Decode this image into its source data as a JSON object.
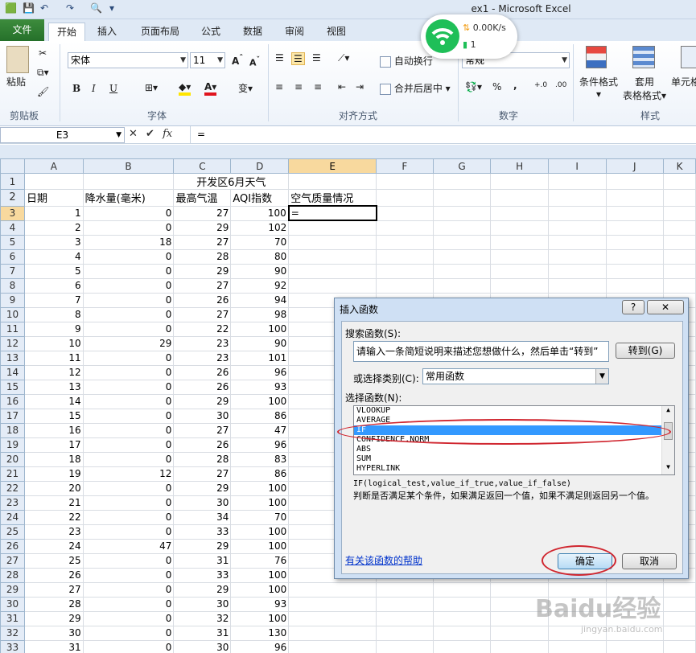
{
  "window": {
    "title": "ex1 - Microsoft Excel"
  },
  "tabs": [
    "开始",
    "插入",
    "页面布局",
    "公式",
    "数据",
    "审阅",
    "视图"
  ],
  "file_tab": "文件",
  "ribbon": {
    "paste": "粘贴",
    "font_name": "宋体",
    "font_size": "11",
    "bold": "B",
    "italic": "I",
    "underline": "U",
    "wrap_text": "自动换行",
    "merge_center": "合并后居中",
    "number_format": "常规",
    "percent": "%",
    "comma": ",",
    "cond_format": "条件格式",
    "table_format_1": "套用",
    "table_format_2": "表格格式",
    "cell_styles": "单元格",
    "groups": {
      "clipboard": "剪贴板",
      "font": "字体",
      "alignment": "对齐方式",
      "number": "数字",
      "styles": "样式"
    }
  },
  "wifi_badge": {
    "speed": "0.00K/s",
    "count": "1"
  },
  "formula_bar": {
    "name_box": "E3",
    "formula": "="
  },
  "columns": [
    "A",
    "B",
    "C",
    "D",
    "E",
    "F",
    "G",
    "H",
    "I",
    "J",
    "K"
  ],
  "sheet": {
    "title": "开发区6月天气",
    "headers": [
      "日期",
      "降水量(毫米)",
      "最高气温",
      "AQI指数",
      "空气质量情况"
    ],
    "rows": [
      {
        "r": "3",
        "a": "1",
        "b": "0",
        "c": "27",
        "d": "100",
        "e": "="
      },
      {
        "r": "4",
        "a": "2",
        "b": "0",
        "c": "29",
        "d": "102"
      },
      {
        "r": "5",
        "a": "3",
        "b": "18",
        "c": "27",
        "d": "70"
      },
      {
        "r": "6",
        "a": "4",
        "b": "0",
        "c": "28",
        "d": "80"
      },
      {
        "r": "7",
        "a": "5",
        "b": "0",
        "c": "29",
        "d": "90"
      },
      {
        "r": "8",
        "a": "6",
        "b": "0",
        "c": "27",
        "d": "92"
      },
      {
        "r": "9",
        "a": "7",
        "b": "0",
        "c": "26",
        "d": "94"
      },
      {
        "r": "10",
        "a": "8",
        "b": "0",
        "c": "27",
        "d": "98"
      },
      {
        "r": "11",
        "a": "9",
        "b": "0",
        "c": "22",
        "d": "100"
      },
      {
        "r": "12",
        "a": "10",
        "b": "29",
        "c": "23",
        "d": "90"
      },
      {
        "r": "13",
        "a": "11",
        "b": "0",
        "c": "23",
        "d": "101"
      },
      {
        "r": "14",
        "a": "12",
        "b": "0",
        "c": "26",
        "d": "96"
      },
      {
        "r": "15",
        "a": "13",
        "b": "0",
        "c": "26",
        "d": "93"
      },
      {
        "r": "16",
        "a": "14",
        "b": "0",
        "c": "29",
        "d": "100"
      },
      {
        "r": "17",
        "a": "15",
        "b": "0",
        "c": "30",
        "d": "86"
      },
      {
        "r": "18",
        "a": "16",
        "b": "0",
        "c": "27",
        "d": "47"
      },
      {
        "r": "19",
        "a": "17",
        "b": "0",
        "c": "26",
        "d": "96"
      },
      {
        "r": "20",
        "a": "18",
        "b": "0",
        "c": "28",
        "d": "83"
      },
      {
        "r": "21",
        "a": "19",
        "b": "12",
        "c": "27",
        "d": "86"
      },
      {
        "r": "22",
        "a": "20",
        "b": "0",
        "c": "29",
        "d": "100"
      },
      {
        "r": "23",
        "a": "21",
        "b": "0",
        "c": "30",
        "d": "100"
      },
      {
        "r": "24",
        "a": "22",
        "b": "0",
        "c": "34",
        "d": "70"
      },
      {
        "r": "25",
        "a": "23",
        "b": "0",
        "c": "33",
        "d": "100"
      },
      {
        "r": "26",
        "a": "24",
        "b": "47",
        "c": "29",
        "d": "100"
      },
      {
        "r": "27",
        "a": "25",
        "b": "0",
        "c": "31",
        "d": "76"
      },
      {
        "r": "28",
        "a": "26",
        "b": "0",
        "c": "33",
        "d": "100"
      },
      {
        "r": "29",
        "a": "27",
        "b": "0",
        "c": "29",
        "d": "100"
      },
      {
        "r": "30",
        "a": "28",
        "b": "0",
        "c": "30",
        "d": "93"
      },
      {
        "r": "31",
        "a": "29",
        "b": "0",
        "c": "32",
        "d": "100"
      },
      {
        "r": "32",
        "a": "30",
        "b": "0",
        "c": "31",
        "d": "130"
      },
      {
        "r": "33",
        "a": "31",
        "b": "0",
        "c": "30",
        "d": "96"
      }
    ]
  },
  "dialog": {
    "title": "插入函数",
    "help_btn": "?",
    "close_btn": "✕",
    "search_label": "搜索函数(S):",
    "search_value": "请输入一条简短说明来描述您想做什么，然后单击“转到”",
    "go_btn": "转到(G)",
    "category_label": "或选择类别(C):",
    "category_value": "常用函数",
    "select_label": "选择函数(N):",
    "functions": [
      "VLOOKUP",
      "AVERAGE",
      "IF",
      "CONFIDENCE.NORM",
      "ABS",
      "SUM",
      "HYPERLINK"
    ],
    "selected_function": "IF",
    "signature": "IF(logical_test,value_if_true,value_if_false)",
    "description": "判断是否满足某个条件，如果满足返回一个值，如果不满足则返回另一个值。",
    "help_link": "有关该函数的帮助",
    "ok_btn": "确定",
    "cancel_btn": "取消"
  },
  "watermark": {
    "main": "Baidu经验",
    "sub": "jingyan.baidu.com"
  }
}
